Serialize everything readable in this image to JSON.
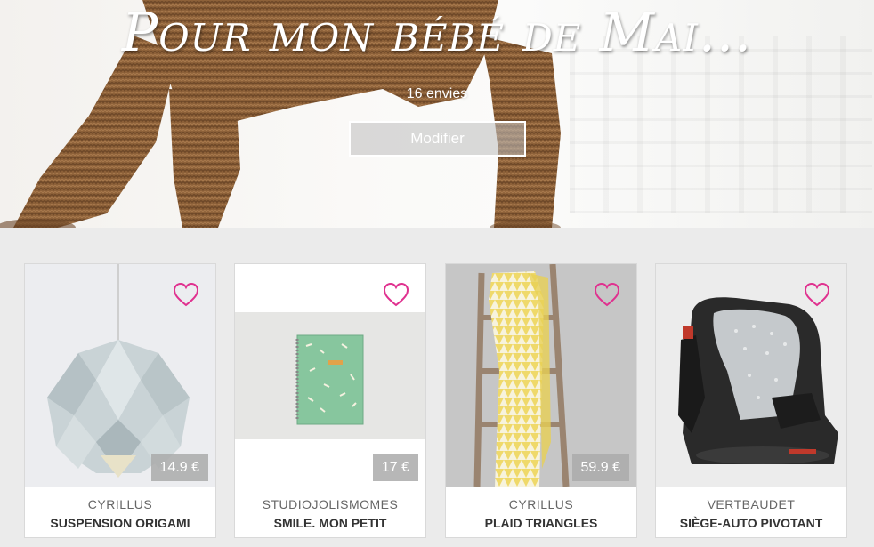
{
  "hero": {
    "title": "Pour mon bébé de Mai...",
    "wish_count": "16 envies",
    "edit_label": "Modifier"
  },
  "colors": {
    "heart": "#e0318f",
    "price_badge": "#aaaaaa",
    "page_bg": "#ebebeb"
  },
  "products": [
    {
      "brand": "CYRILLUS",
      "name": "SUSPENSION ORIGAMI",
      "price": "14.9 €",
      "icon": "heart-outline-icon"
    },
    {
      "brand": "STUDIOJOLISMOMES",
      "name": "SMILE. MON PETIT",
      "price": "17 €",
      "icon": "heart-outline-icon"
    },
    {
      "brand": "CYRILLUS",
      "name": "PLAID TRIANGLES",
      "price": "59.9 €",
      "icon": "heart-outline-icon"
    },
    {
      "brand": "VERTBAUDET",
      "name": "SIÈGE-AUTO PIVOTANT",
      "price": "",
      "icon": "heart-outline-icon"
    }
  ]
}
